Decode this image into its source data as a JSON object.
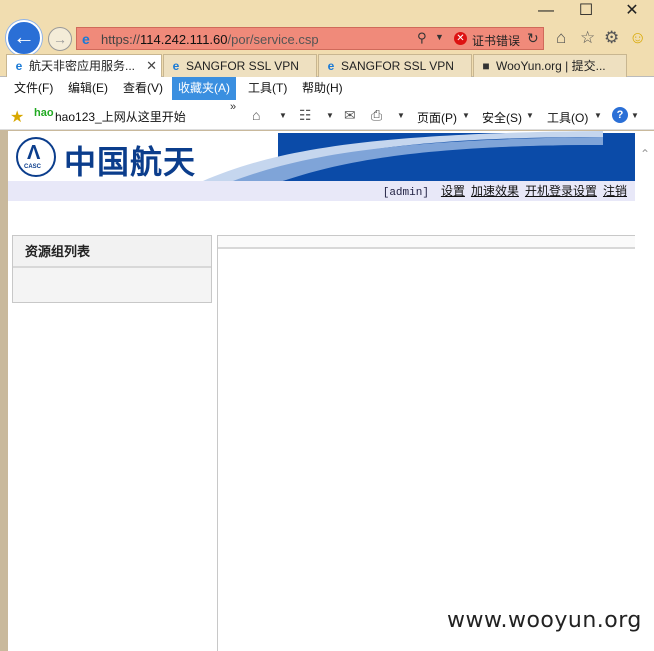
{
  "window": {
    "minimize_glyph": "—",
    "maximize_glyph": "☐",
    "close_glyph": "✕"
  },
  "address": {
    "scheme": "https://",
    "host": "114.242.111.60",
    "path": "/por/service.csp",
    "cert_error": "证书错误"
  },
  "tabs": [
    {
      "label": "航天非密应用服务...",
      "active": true,
      "icon": "ie-icon"
    },
    {
      "label": "SANGFOR SSL VPN",
      "active": false,
      "icon": "ie-icon"
    },
    {
      "label": "SANGFOR SSL VPN",
      "active": false,
      "icon": "ie-icon"
    },
    {
      "label": "WooYun.org | 提交...",
      "active": false,
      "icon": "wooyun-icon"
    }
  ],
  "menu": [
    {
      "label": "文件(F)"
    },
    {
      "label": "编辑(E)"
    },
    {
      "label": "查看(V)"
    },
    {
      "label": "收藏夹(A)",
      "active": true
    },
    {
      "label": "工具(T)"
    },
    {
      "label": "帮助(H)"
    }
  ],
  "command_bar": {
    "favorite_link": "hao123_上网从这里开始",
    "hao_label": "hao",
    "page_label": "页面(P)",
    "safety_label": "安全(S)",
    "tools_label": "工具(O)"
  },
  "page": {
    "logo_casc": "CASC",
    "logo_text": "中国航天",
    "user": "[admin]",
    "links": [
      "设置",
      "加速效果",
      "开机登录设置",
      "注销"
    ],
    "left_panel_title": "资源组列表"
  },
  "watermark": "www.wooyun.org",
  "colors": {
    "address_bar_error": "#f08a7a",
    "banner_blue": "#0b4ba8",
    "menu_active": "#3a8fe0"
  }
}
